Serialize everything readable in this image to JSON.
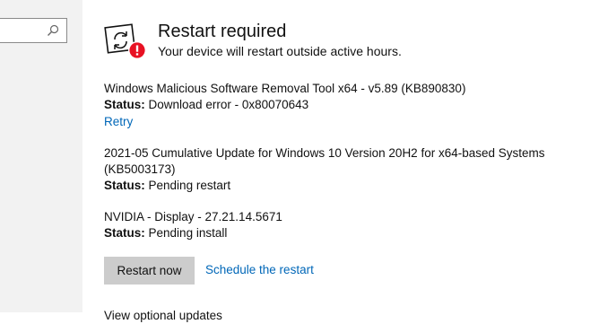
{
  "hero": {
    "title": "Restart required",
    "subtitle": "Your device will restart outside active hours.",
    "icon": "restart-required-icon",
    "alert_color": "#e81123"
  },
  "updates": [
    {
      "name": "Windows Malicious Software Removal Tool x64 - v5.89 (KB890830)",
      "status_label": "Status:",
      "status_value": "Download error - 0x80070643",
      "action": "Retry"
    },
    {
      "name_line1": "2021-05 Cumulative Update for Windows 10 Version 20H2 for x64-based Systems",
      "name_line2": "(KB5003173)",
      "status_label": "Status:",
      "status_value": "Pending restart"
    },
    {
      "name": "NVIDIA - Display - 27.21.14.5671",
      "status_label": "Status:",
      "status_value": "Pending install"
    }
  ],
  "actions": {
    "restart_now": "Restart now",
    "schedule": "Schedule the restart"
  },
  "bottom": {
    "text": "View optional updates"
  },
  "colors": {
    "link": "#0067b8",
    "sidebar": "#f2f2f2",
    "button": "#cccccc"
  }
}
